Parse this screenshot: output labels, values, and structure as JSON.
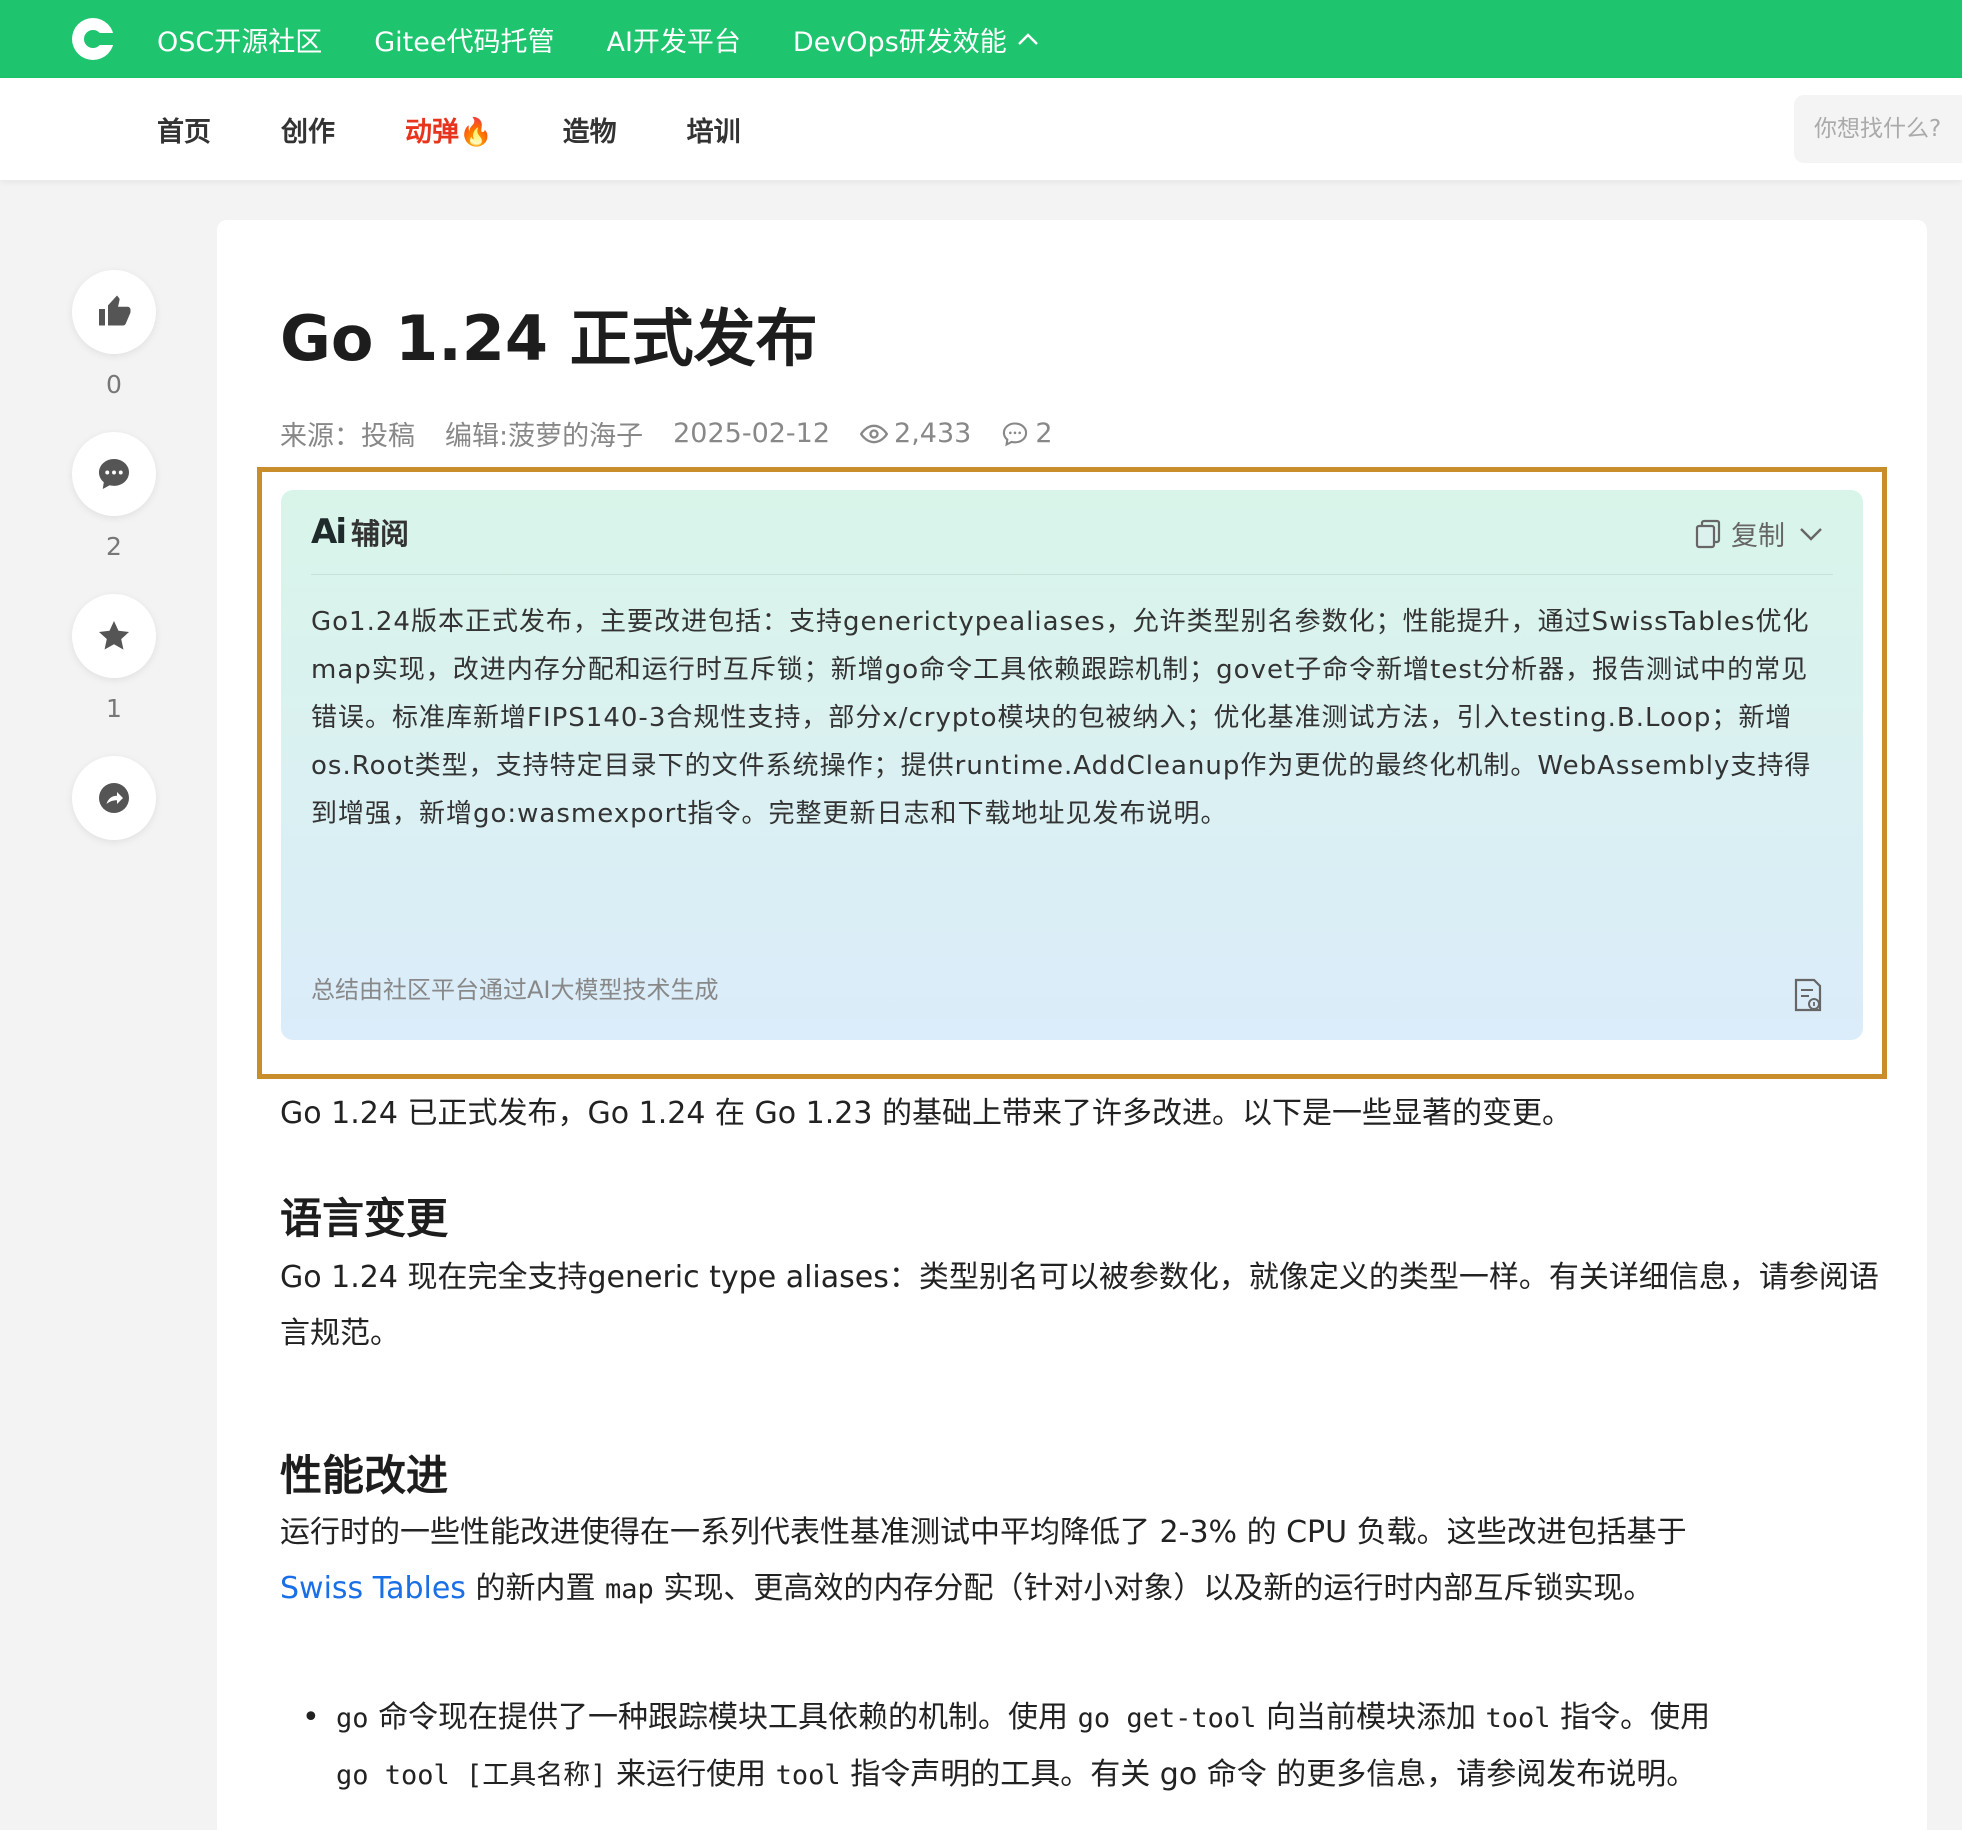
{
  "topnav": {
    "items": [
      "OSC开源社区",
      "Gitee代码托管",
      "AI开发平台",
      "DevOps研发效能"
    ]
  },
  "subnav": {
    "items": [
      "首页",
      "创作",
      "动弹🔥",
      "造物",
      "培训"
    ],
    "search_placeholder": "你想找什么?"
  },
  "side": {
    "like_count": "0",
    "comment_count": "2",
    "fav_count": "1"
  },
  "article": {
    "title": "Go 1.24 正式发布",
    "source": "来源：投稿",
    "editor": "编辑:菠萝的海子",
    "date": "2025-02-12",
    "views": "2,433",
    "comments": "2"
  },
  "ai": {
    "logo": "Ai",
    "label": "辅阅",
    "copy_label": "复制",
    "summary": "Go1.24版本正式发布，主要改进包括：支持generictypealiases，允许类型别名参数化；性能提升，通过SwissTables优化map实现，改进内存分配和运行时互斥锁；新增go命令工具依赖跟踪机制；govet子命令新增test分析器，报告测试中的常见错误。标准库新增FIPS140-3合规性支持，部分x/crypto模块的包被纳入；优化基准测试方法，引入testing.B.Loop；新增os.Root类型，支持特定目录下的文件系统操作；提供runtime.AddCleanup作为更优的最终化机制。WebAssembly支持得到增强，新增go:wasmexport指令。完整更新日志和下载地址见发布说明。",
    "footer": "总结由社区平台通过AI大模型技术生成"
  },
  "body": {
    "intro": "Go 1.24 已正式发布，Go 1.24 在 Go 1.23 的基础上带来了许多改进。以下是一些显著的变更。",
    "h_lang": "语言变更",
    "p_lang": "Go 1.24 现在完全支持generic type aliases：类型别名可以被参数化，就像定义的类型一样。有关详细信息，请参阅语言规范。",
    "h_perf": "性能改进",
    "p_perf_1": "运行时的一些性能改进使得在一系列代表性基准测试中平均降低了 2-3% 的 CPU 负载。这些改进包括基于",
    "p_perf_link": "Swiss Tables",
    "p_perf_2": "的新内置",
    "p_perf_code": "map",
    "p_perf_3": "实现、更高效的内存分配（针对小对象）以及新的运行时内部互斥锁实现。",
    "b1_code1": "go",
    "b1_t1": "命令现在提供了一种跟踪模块工具依赖的机制。使用",
    "b1_code2": "go get-tool",
    "b1_t2": "向当前模块添加",
    "b1_code3": "tool",
    "b1_t3": "指令。使用",
    "b1_code4": "go tool [工具名称]",
    "b1_t4": "来运行使用",
    "b1_code5": "tool",
    "b1_t5": "指令声明的工具。有关 go 命令 的更多信息，请参阅发布说明。"
  }
}
